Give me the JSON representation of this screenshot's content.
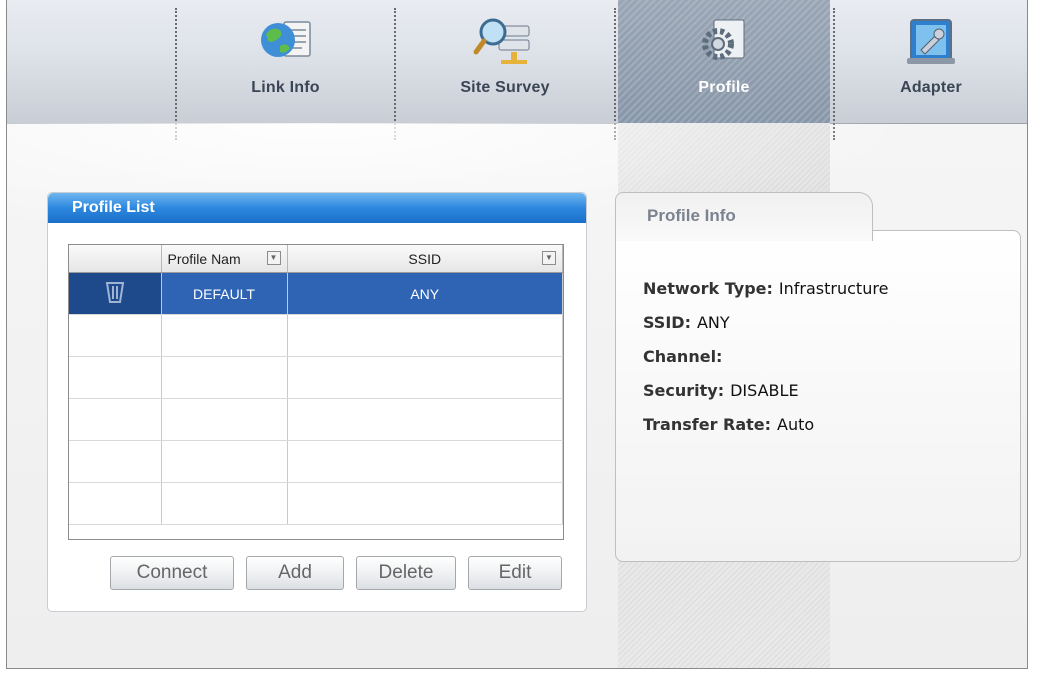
{
  "nav": {
    "tabs": [
      {
        "label": "Link Info",
        "icon": "globe-document-icon"
      },
      {
        "label": "Site Survey",
        "icon": "magnifier-network-icon"
      },
      {
        "label": "Profile",
        "icon": "gear-document-icon",
        "active": true
      },
      {
        "label": "Adapter",
        "icon": "adapter-screen-icon"
      }
    ]
  },
  "profile_list": {
    "title": "Profile List",
    "columns": [
      "Profile Nam",
      "SSID"
    ],
    "rows": [
      {
        "profile_name": "DEFAULT",
        "ssid": "ANY",
        "selected": true
      }
    ],
    "buttons": {
      "connect": "Connect",
      "add": "Add",
      "delete": "Delete",
      "edit": "Edit"
    }
  },
  "profile_info": {
    "title": "Profile Info",
    "network_type_label": "Network Type:",
    "network_type_value": "Infrastructure",
    "ssid_label": "SSID:",
    "ssid_value": "ANY",
    "channel_label": "Channel:",
    "channel_value": "",
    "security_label": "Security:",
    "security_value": "DISABLE",
    "transfer_rate_label": "Transfer Rate:",
    "transfer_rate_value": "Auto"
  },
  "colors": {
    "header_blue": "#2d87de",
    "selected_row": "#2f64b5",
    "active_tab": "#8796a8"
  }
}
